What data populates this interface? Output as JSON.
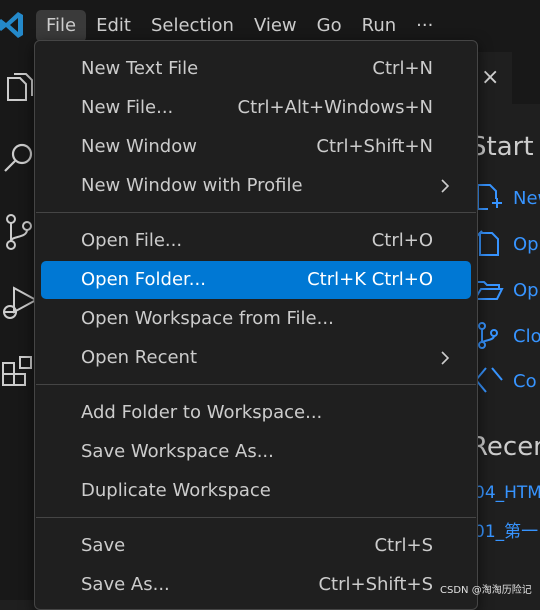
{
  "menubar": {
    "items": [
      "File",
      "Edit",
      "Selection",
      "View",
      "Go",
      "Run",
      "···"
    ]
  },
  "file_menu": {
    "items": [
      {
        "label": "New Text File",
        "shortcut": "Ctrl+N"
      },
      {
        "label": "New File...",
        "shortcut": "Ctrl+Alt+Windows+N"
      },
      {
        "label": "New Window",
        "shortcut": "Ctrl+Shift+N"
      },
      {
        "label": "New Window with Profile",
        "shortcut": ""
      },
      {
        "label": "Open File...",
        "shortcut": "Ctrl+O"
      },
      {
        "label": "Open Folder...",
        "shortcut": "Ctrl+K Ctrl+O"
      },
      {
        "label": "Open Workspace from File...",
        "shortcut": ""
      },
      {
        "label": "Open Recent",
        "shortcut": ""
      },
      {
        "label": "Add Folder to Workspace...",
        "shortcut": ""
      },
      {
        "label": "Save Workspace As...",
        "shortcut": ""
      },
      {
        "label": "Duplicate Workspace",
        "shortcut": ""
      },
      {
        "label": "Save",
        "shortcut": "Ctrl+S"
      },
      {
        "label": "Save As...",
        "shortcut": "Ctrl+Shift+S"
      }
    ],
    "highlighted": "Open Folder..."
  },
  "welcome": {
    "tab_close": "×",
    "start_heading": "Start",
    "start_links": [
      "New",
      "Op",
      "Op",
      "Clo",
      "Co"
    ],
    "recent_heading": "Recen",
    "recent_items": [
      "04_HTM",
      "01_第一"
    ]
  },
  "watermark": "CSDN @淘淘历险记",
  "colors": {
    "accent": "#0078d4",
    "link": "#3794ff",
    "vscode_blue": "#2489ca"
  },
  "icons": {
    "activity": [
      "explorer-icon",
      "search-icon",
      "source-control-icon",
      "run-debug-icon",
      "extensions-icon"
    ],
    "welcome": [
      "new-file-icon",
      "open-file-icon",
      "open-folder-icon",
      "clone-git-icon",
      "connect-icon"
    ]
  }
}
